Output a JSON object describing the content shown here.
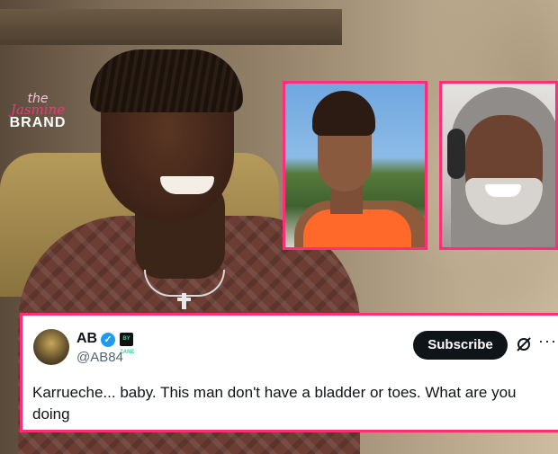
{
  "watermark": {
    "line1": "the",
    "line2": "Jasmine",
    "line3": "BRAND"
  },
  "tweet": {
    "display_name": "AB",
    "handle": "@AB84",
    "verified_glyph": "✓",
    "affiliate_badge_text": "BY ZANE",
    "subscribe_label": "Subscribe",
    "more_glyph": "···",
    "text": "Karrueche... baby. This man don't have a bladder or toes. What are you doing"
  },
  "icons": {
    "verified": "verified-badge-icon",
    "affiliate": "affiliate-badge-icon",
    "grok": "grok-icon",
    "more": "more-options-icon"
  },
  "colors": {
    "frame_accent": "#ff2e78",
    "verified_blue": "#1d9bf0",
    "subscribe_bg": "#0f1419"
  }
}
